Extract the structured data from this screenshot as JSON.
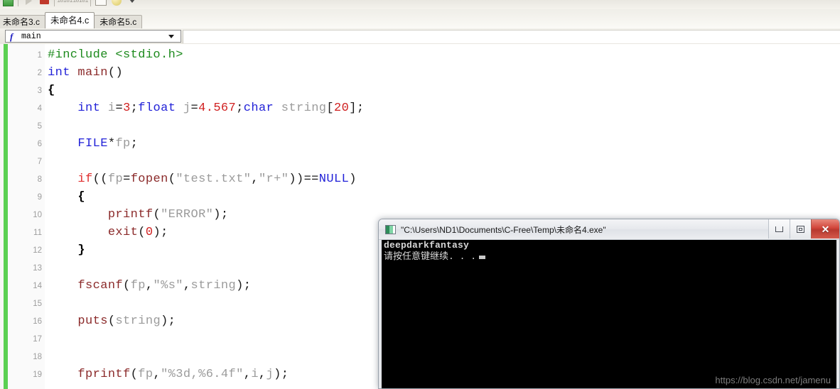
{
  "toolbar": {
    "items": [
      {
        "name": "save-icon",
        "glyph": "save"
      },
      {
        "name": "separator",
        "glyph": "sep"
      },
      {
        "name": "run-icon",
        "glyph": "play"
      },
      {
        "name": "stop-icon",
        "glyph": "stop"
      },
      {
        "name": "separator",
        "glyph": "sep"
      },
      {
        "name": "binary-toggle-icon",
        "glyph": "bin",
        "label": "10101"
      },
      {
        "name": "binary-step-icon",
        "glyph": "bin",
        "label": "10101"
      },
      {
        "name": "separator",
        "glyph": "sep"
      },
      {
        "name": "window-icon",
        "glyph": "win"
      },
      {
        "name": "help-ball-icon",
        "glyph": "ball"
      },
      {
        "name": "overflow-caret-icon",
        "glyph": "caret"
      }
    ]
  },
  "tabs": [
    {
      "label": "未命名3.c",
      "active": false
    },
    {
      "label": "未命名4.c",
      "active": true
    },
    {
      "label": "未命名5.c",
      "active": false
    }
  ],
  "function_selector": {
    "icon": "function-icon",
    "icon_glyph": "f",
    "value": "main"
  },
  "editor": {
    "lines": [
      {
        "n": "1",
        "tokens": [
          {
            "t": "#include ",
            "c": "t-pre"
          },
          {
            "t": "<stdio.h>",
            "c": "t-pre"
          }
        ]
      },
      {
        "n": "2",
        "tokens": [
          {
            "t": "int",
            "c": "t-kw"
          },
          {
            "t": " ",
            "c": "t-op"
          },
          {
            "t": "main",
            "c": "t-fn"
          },
          {
            "t": "()",
            "c": "t-punct"
          }
        ]
      },
      {
        "n": "3",
        "tokens": [
          {
            "t": "{",
            "c": "t-brace"
          }
        ]
      },
      {
        "n": "4",
        "tokens": [
          {
            "t": "    ",
            "c": "t-op"
          },
          {
            "t": "int",
            "c": "t-kw"
          },
          {
            "t": " ",
            "c": "t-op"
          },
          {
            "t": "i",
            "c": "t-id"
          },
          {
            "t": "=",
            "c": "t-op"
          },
          {
            "t": "3",
            "c": "t-num"
          },
          {
            "t": ";",
            "c": "t-punct"
          },
          {
            "t": "float",
            "c": "t-kw"
          },
          {
            "t": " ",
            "c": "t-op"
          },
          {
            "t": "j",
            "c": "t-id"
          },
          {
            "t": "=",
            "c": "t-op"
          },
          {
            "t": "4.567",
            "c": "t-num"
          },
          {
            "t": ";",
            "c": "t-punct"
          },
          {
            "t": "char",
            "c": "t-kw"
          },
          {
            "t": " ",
            "c": "t-op"
          },
          {
            "t": "string",
            "c": "t-id"
          },
          {
            "t": "[",
            "c": "t-punct"
          },
          {
            "t": "20",
            "c": "t-num"
          },
          {
            "t": "];",
            "c": "t-punct"
          }
        ]
      },
      {
        "n": "5",
        "tokens": []
      },
      {
        "n": "6",
        "tokens": [
          {
            "t": "    ",
            "c": "t-op"
          },
          {
            "t": "FILE",
            "c": "t-kw"
          },
          {
            "t": "*",
            "c": "t-op"
          },
          {
            "t": "fp",
            "c": "t-id"
          },
          {
            "t": ";",
            "c": "t-punct"
          }
        ]
      },
      {
        "n": "7",
        "tokens": []
      },
      {
        "n": "8",
        "tokens": [
          {
            "t": "    ",
            "c": "t-op"
          },
          {
            "t": "if",
            "c": "t-ctl"
          },
          {
            "t": "((",
            "c": "t-punct"
          },
          {
            "t": "fp",
            "c": "t-id"
          },
          {
            "t": "=",
            "c": "t-op"
          },
          {
            "t": "fopen",
            "c": "t-fn"
          },
          {
            "t": "(",
            "c": "t-punct"
          },
          {
            "t": "\"test.txt\"",
            "c": "t-str"
          },
          {
            "t": ",",
            "c": "t-punct"
          },
          {
            "t": "\"r+\"",
            "c": "t-str"
          },
          {
            "t": "))==",
            "c": "t-punct"
          },
          {
            "t": "NULL",
            "c": "t-kw"
          },
          {
            "t": ")",
            "c": "t-punct"
          }
        ]
      },
      {
        "n": "9",
        "tokens": [
          {
            "t": "    ",
            "c": "t-op"
          },
          {
            "t": "{",
            "c": "t-brace"
          }
        ]
      },
      {
        "n": "10",
        "tokens": [
          {
            "t": "        ",
            "c": "t-op"
          },
          {
            "t": "printf",
            "c": "t-fn"
          },
          {
            "t": "(",
            "c": "t-punct"
          },
          {
            "t": "\"ERROR\"",
            "c": "t-str"
          },
          {
            "t": ");",
            "c": "t-punct"
          }
        ]
      },
      {
        "n": "11",
        "tokens": [
          {
            "t": "        ",
            "c": "t-op"
          },
          {
            "t": "exit",
            "c": "t-fn"
          },
          {
            "t": "(",
            "c": "t-punct"
          },
          {
            "t": "0",
            "c": "t-num"
          },
          {
            "t": ");",
            "c": "t-punct"
          }
        ]
      },
      {
        "n": "12",
        "tokens": [
          {
            "t": "    ",
            "c": "t-op"
          },
          {
            "t": "}",
            "c": "t-brace"
          }
        ]
      },
      {
        "n": "13",
        "tokens": []
      },
      {
        "n": "14",
        "tokens": [
          {
            "t": "    ",
            "c": "t-op"
          },
          {
            "t": "fscanf",
            "c": "t-fn"
          },
          {
            "t": "(",
            "c": "t-punct"
          },
          {
            "t": "fp",
            "c": "t-id"
          },
          {
            "t": ",",
            "c": "t-punct"
          },
          {
            "t": "\"%s\"",
            "c": "t-str"
          },
          {
            "t": ",",
            "c": "t-punct"
          },
          {
            "t": "string",
            "c": "t-id"
          },
          {
            "t": ");",
            "c": "t-punct"
          }
        ]
      },
      {
        "n": "15",
        "tokens": []
      },
      {
        "n": "16",
        "tokens": [
          {
            "t": "    ",
            "c": "t-op"
          },
          {
            "t": "puts",
            "c": "t-fn"
          },
          {
            "t": "(",
            "c": "t-punct"
          },
          {
            "t": "string",
            "c": "t-id"
          },
          {
            "t": ");",
            "c": "t-punct"
          }
        ]
      },
      {
        "n": "17",
        "tokens": []
      },
      {
        "n": "18",
        "tokens": []
      },
      {
        "n": "19",
        "tokens": [
          {
            "t": "    ",
            "c": "t-op"
          },
          {
            "t": "fprintf",
            "c": "t-fn"
          },
          {
            "t": "(",
            "c": "t-punct"
          },
          {
            "t": "fp",
            "c": "t-id"
          },
          {
            "t": ",",
            "c": "t-punct"
          },
          {
            "t": "\"%3d,%6.4f\"",
            "c": "t-str"
          },
          {
            "t": ",",
            "c": "t-punct"
          },
          {
            "t": "i",
            "c": "t-id"
          },
          {
            "t": ",",
            "c": "t-punct"
          },
          {
            "t": "j",
            "c": "t-id"
          },
          {
            "t": ");",
            "c": "t-punct"
          }
        ]
      }
    ]
  },
  "console_window": {
    "title": "\"C:\\Users\\ND1\\Documents\\C-Free\\Temp\\未命名4.exe\"",
    "app_icon": "console-app-icon",
    "buttons": {
      "minimize": "minimize-button",
      "maximize": "maximize-button",
      "close": "close-button",
      "close_glyph": "✕"
    },
    "output": [
      "deepdarkfantasy",
      "请按任意键继续. . ."
    ]
  },
  "watermark": "https://blog.csdn.net/jamenu",
  "colors": {
    "change_bar_green": "#5bd052",
    "preprocessor_green": "#1d8a1d",
    "keyword_blue": "#2222d8",
    "function_maroon": "#8b2a2a",
    "control_red": "#e03030",
    "number_red": "#d02020",
    "string_gray": "#9b9b9b",
    "close_button_red": "#d2453a",
    "console_background": "#000000",
    "console_text": "#d8d8d8"
  }
}
